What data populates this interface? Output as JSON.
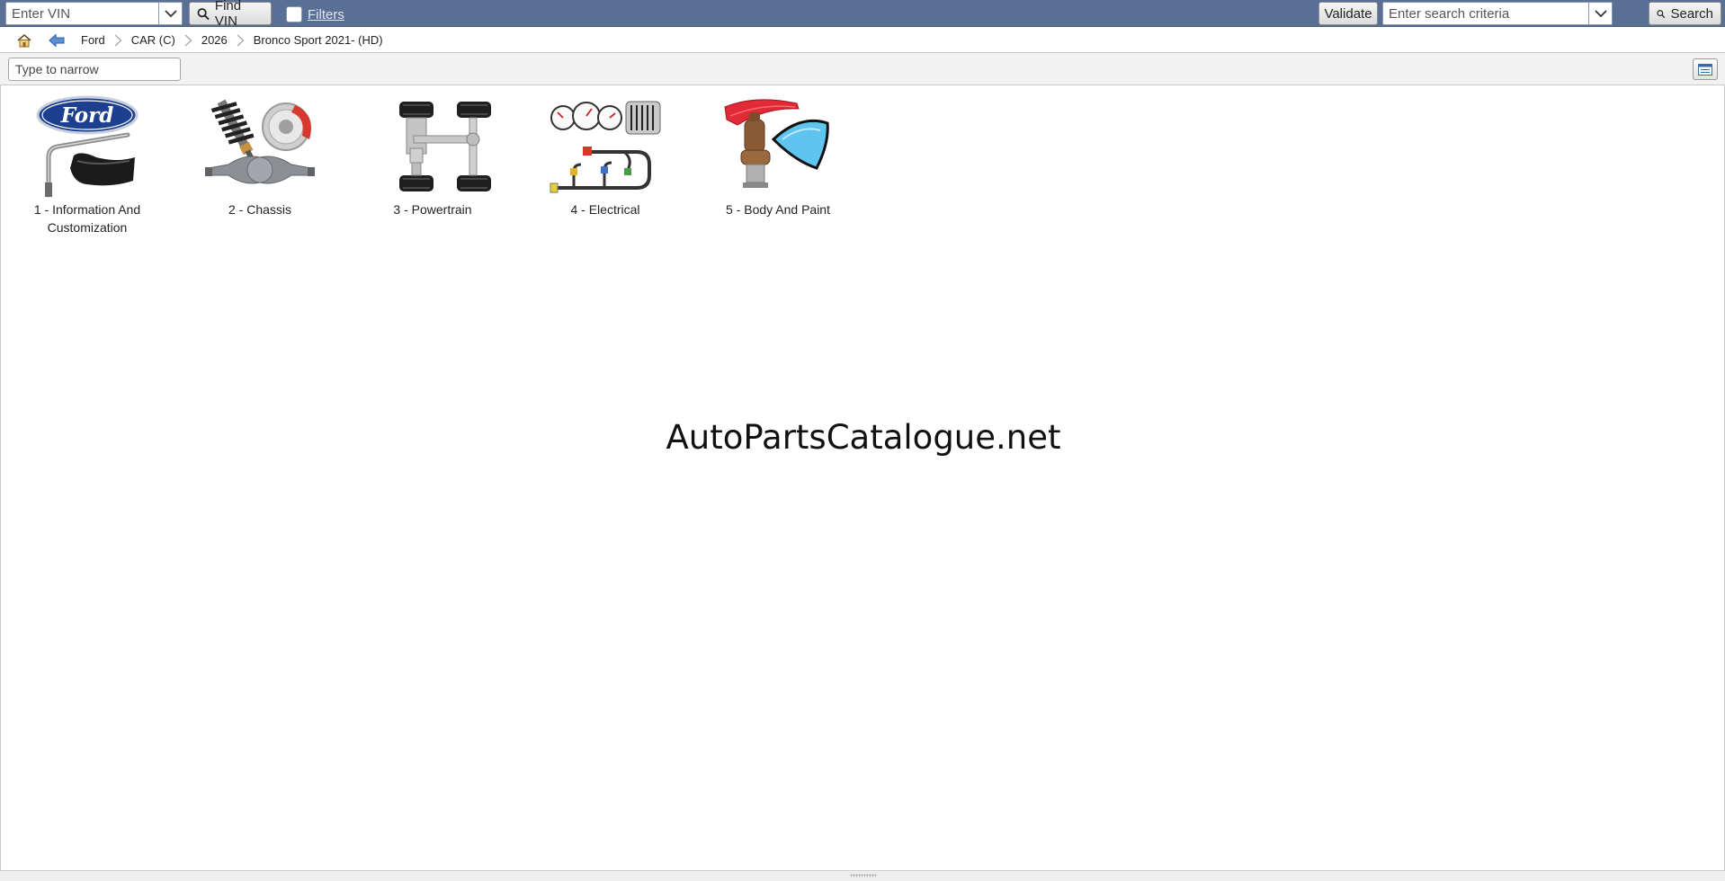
{
  "toolbar": {
    "vin_placeholder": "Enter VIN",
    "find_vin_label": "Find VIN",
    "filters_label": "Filters",
    "validate_label": "Validate",
    "search_placeholder": "Enter search criteria",
    "search_label": "Search",
    "background_color": "#5a6f94"
  },
  "breadcrumb": {
    "items": [
      "Ford",
      "CAR (C)",
      "2026",
      "Bronco Sport 2021- (HD)"
    ]
  },
  "filterbar": {
    "narrow_placeholder": "Type to narrow"
  },
  "categories": [
    {
      "label": "1 - Information And Customization",
      "icon": "ford-logo-icon"
    },
    {
      "label": "2 - Chassis",
      "icon": "chassis-icon"
    },
    {
      "label": "3 - Powertrain",
      "icon": "powertrain-icon"
    },
    {
      "label": "4 - Electrical",
      "icon": "electrical-icon"
    },
    {
      "label": "5 - Body And Paint",
      "icon": "body-paint-icon"
    }
  ],
  "watermark": "AutoPartsCatalogue.net"
}
